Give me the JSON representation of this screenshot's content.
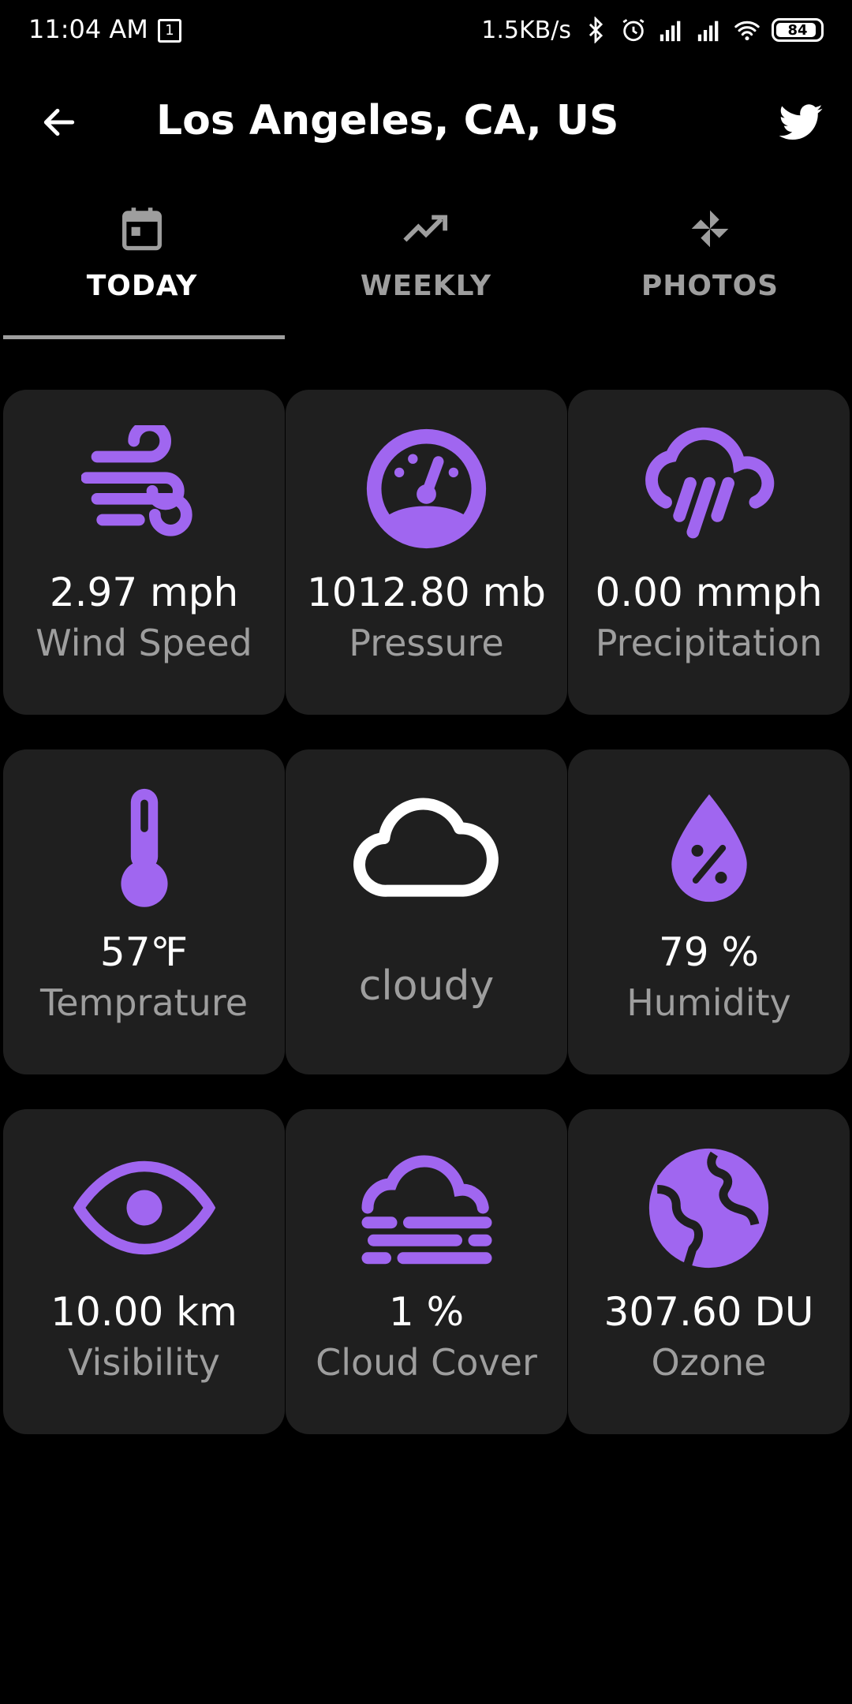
{
  "status_bar": {
    "time": "11:04 AM",
    "notification_count": "1",
    "network_speed": "1.5KB/s",
    "battery_level": "84"
  },
  "app_bar": {
    "title": "Los Angeles, CA, US",
    "back_icon": "arrow-back-icon",
    "share_icon": "twitter-icon"
  },
  "tabs": [
    {
      "label": "TODAY",
      "icon": "calendar-icon",
      "active": true
    },
    {
      "label": "WEEKLY",
      "icon": "trending-up-icon",
      "active": false
    },
    {
      "label": "PHOTOS",
      "icon": "pinwheel-icon",
      "active": false
    }
  ],
  "accent_color": "#a066f0",
  "cards": {
    "wind": {
      "value": "2.97 mph",
      "label": "Wind Speed",
      "icon": "wind-icon"
    },
    "pressure": {
      "value": "1012.80 mb",
      "label": "Pressure",
      "icon": "gauge-icon"
    },
    "precipitation": {
      "value": "0.00 mmph",
      "label": "Precipitation",
      "icon": "rain-cloud-icon"
    },
    "temperature": {
      "value": "57℉",
      "label": "Temprature",
      "icon": "thermometer-icon"
    },
    "condition": {
      "label": "cloudy",
      "icon": "cloud-icon"
    },
    "humidity": {
      "value": "79 %",
      "label": "Humidity",
      "icon": "humidity-drop-icon"
    },
    "visibility": {
      "value": "10.00 km",
      "label": "Visibility",
      "icon": "eye-icon"
    },
    "cloud_cover": {
      "value": "1 %",
      "label": "Cloud Cover",
      "icon": "fog-cloud-icon"
    },
    "ozone": {
      "value": "307.60 DU",
      "label": "Ozone",
      "icon": "globe-icon"
    }
  }
}
